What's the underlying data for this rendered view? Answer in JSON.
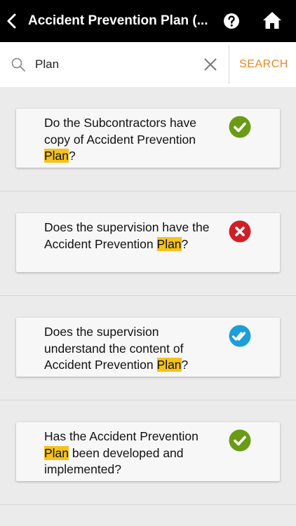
{
  "header": {
    "title": "Accident Prevention Plan (...",
    "back_icon": "back-arrow-icon",
    "help_icon": "help-icon",
    "home_icon": "home-icon"
  },
  "search": {
    "value": "Plan",
    "placeholder": "",
    "button_label": "SEARCH"
  },
  "items": [
    {
      "parts": [
        "Do the Subcontractors have copy of Accident Prevention ",
        "Plan",
        "?"
      ],
      "status": "check-icon",
      "status_color": "#6a9b16"
    },
    {
      "parts": [
        "Does the supervision have the Accident Prevention ",
        "Plan",
        "?"
      ],
      "status": "cross-icon",
      "status_color": "#d01f27"
    },
    {
      "parts": [
        "Does the supervision understand the content of Accident Prevention ",
        "Plan",
        "?"
      ],
      "status": "double-check-icon",
      "status_color": "#1c9fd6"
    },
    {
      "parts": [
        "Has the Accident Prevention ",
        "Plan",
        " been developed and implemented?"
      ],
      "status": "check-icon",
      "status_color": "#6a9b16"
    }
  ],
  "colors": {
    "header_bg": "#000000",
    "accent": "#e8872a",
    "highlight": "#f6c21a"
  }
}
